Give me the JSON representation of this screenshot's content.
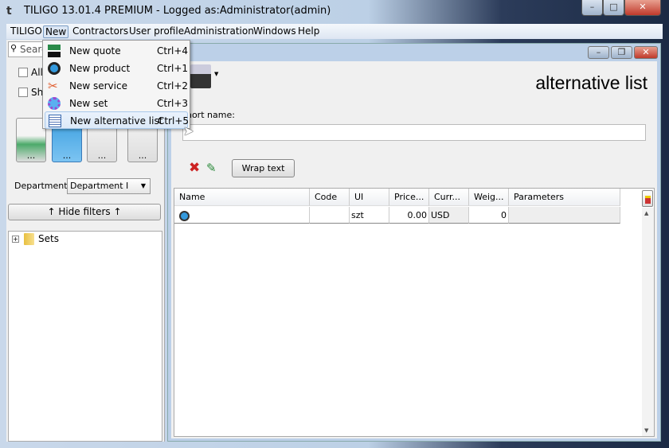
{
  "window": {
    "title": "TILIGO 13.01.4 PREMIUM - Logged as:Administrator(admin)",
    "min": "–",
    "max": "□",
    "close": "✕"
  },
  "menubar": [
    "TILIGO",
    "New",
    "Contractors",
    "User profile",
    "Administration",
    "Windows",
    "Help"
  ],
  "new_menu": [
    {
      "label": "New quote",
      "shortcut": "Ctrl+4",
      "icon": "quote-icon"
    },
    {
      "label": "New product",
      "shortcut": "Ctrl+1",
      "icon": "product-gear-icon"
    },
    {
      "label": "New service",
      "shortcut": "Ctrl+2",
      "icon": "service-tools-icon"
    },
    {
      "label": "New set",
      "shortcut": "Ctrl+3",
      "icon": "set-gear-icon"
    },
    {
      "label": "New alternative list",
      "shortcut": "Ctrl+5",
      "icon": "list-icon",
      "highlighted": true
    }
  ],
  "left": {
    "search_placeholder": "Search",
    "check1": "Allo",
    "check2": "Sho",
    "tiles": [
      "...",
      "...",
      "...",
      "..."
    ],
    "department_label": "Department:",
    "department_value": "Department I",
    "hide_filters": "↑ Hide filters ↑",
    "tree": [
      {
        "label": "Sets",
        "expander": "+"
      }
    ]
  },
  "child": {
    "heading": "alternative list",
    "short_name_label": "Short name:",
    "short_name_value": "",
    "wrap_text": "Wrap text",
    "columns": [
      "Name",
      "Code",
      "UI",
      "Price...",
      "Curr...",
      "Weig...",
      "Parameters"
    ],
    "rows": [
      {
        "name": "",
        "code": "",
        "ui": "szt",
        "price": "0.00",
        "currency": "USD",
        "weight": "0",
        "parameters": ""
      }
    ]
  },
  "colors": {
    "accent": "#3399dd",
    "delete": "#cc2222",
    "edit": "#2a8a3a"
  }
}
